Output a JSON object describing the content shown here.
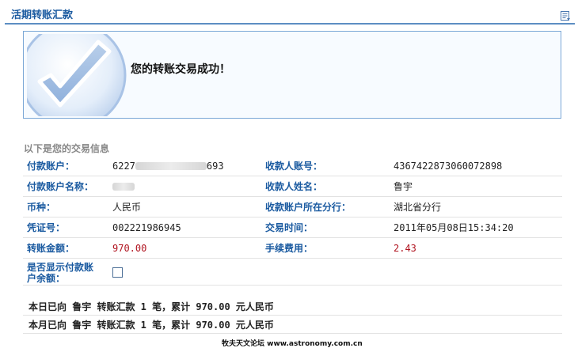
{
  "header": {
    "title": "活期转账汇款"
  },
  "success": {
    "message": "您的转账交易成功！"
  },
  "info": {
    "heading": "以下是您的交易信息",
    "payer_account_label": "付款账户：",
    "payer_account_prefix": "6227",
    "payer_account_suffix": "693",
    "payee_account_label": "收款人账号：",
    "payee_account_value": "4367422873060072898",
    "payer_name_label": "付款账户名称：",
    "payee_name_label": "收款人姓名：",
    "payee_name_value": "鲁宇",
    "currency_label": "币种：",
    "currency_value": "人民币",
    "payee_branch_label": "收款账户所在分行：",
    "payee_branch_value": "湖北省分行",
    "voucher_label": "凭证号：",
    "voucher_value": "002221986945",
    "time_label": "交易时间：",
    "time_value": "2011年05月08日15:34:20",
    "amount_label": "转账金额：",
    "amount_value": "970.00",
    "fee_label": "手续费用：",
    "fee_value": "2.43",
    "show_balance_label_1": "是否显示付款账",
    "show_balance_label_2": "户余额：",
    "show_balance_checked": false
  },
  "summary": {
    "today": "本日已向 鲁宇 转账汇款 1 笔，累计 970.00 元人民币",
    "month": "本月已向 鲁宇 转账汇款 1 笔，累计 970.00 元人民币"
  },
  "footer": {
    "text": "牧夫天文论坛 www.astronomy.com.cn"
  },
  "icons": {
    "header": "document-print-icon",
    "success": "checkmark-icon"
  },
  "colors": {
    "accent": "#1a5aa0",
    "money": "#b0131f",
    "box_border": "#7aa7d6"
  }
}
